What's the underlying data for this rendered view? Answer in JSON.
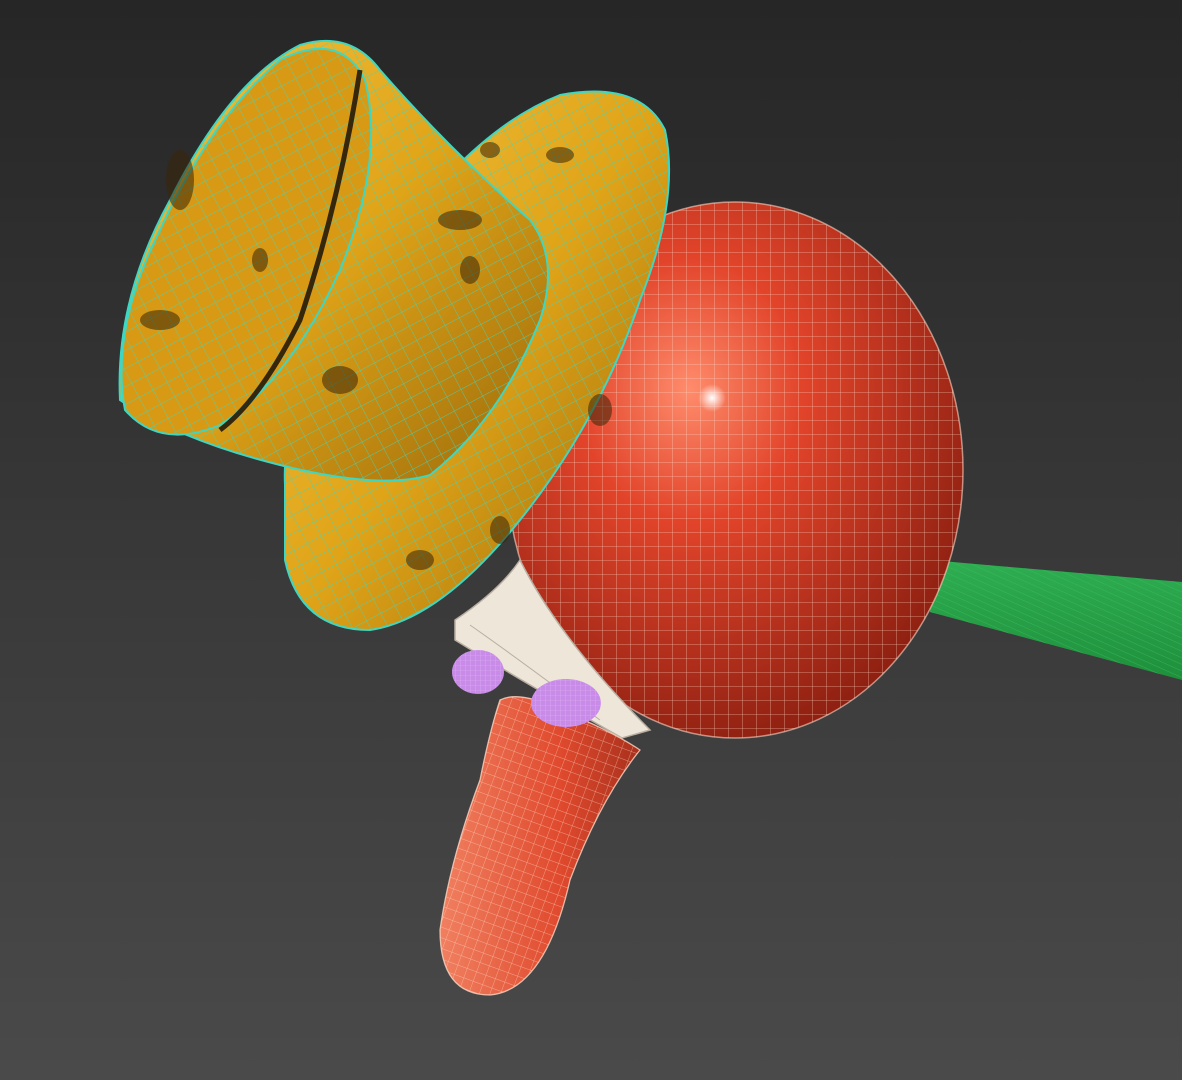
{
  "viewport": {
    "active_border_color": "#a8963a",
    "background_top": "#262626",
    "background_bottom": "#4a4a4a"
  },
  "scene": {
    "objects": [
      {
        "name": "top-hat",
        "surface_color": "#e0a418",
        "wire_color": "#3fd6c2"
      },
      {
        "name": "head-sphere",
        "surface_color": "#e2442a",
        "wire_color": "#ffd7c4"
      },
      {
        "name": "nose",
        "surface_color": "#e04a2e",
        "wire_color": "#ffd7c4"
      },
      {
        "name": "stick-arm",
        "surface_color": "#1f8f3c",
        "wire_color": "#36c25e"
      },
      {
        "name": "scarf-collar",
        "surface_color": "#efe6da",
        "wire_color": "#b9aea2"
      },
      {
        "name": "buttons",
        "surface_color": "#c88be8",
        "wire_color": "#e2b8f7"
      }
    ]
  }
}
